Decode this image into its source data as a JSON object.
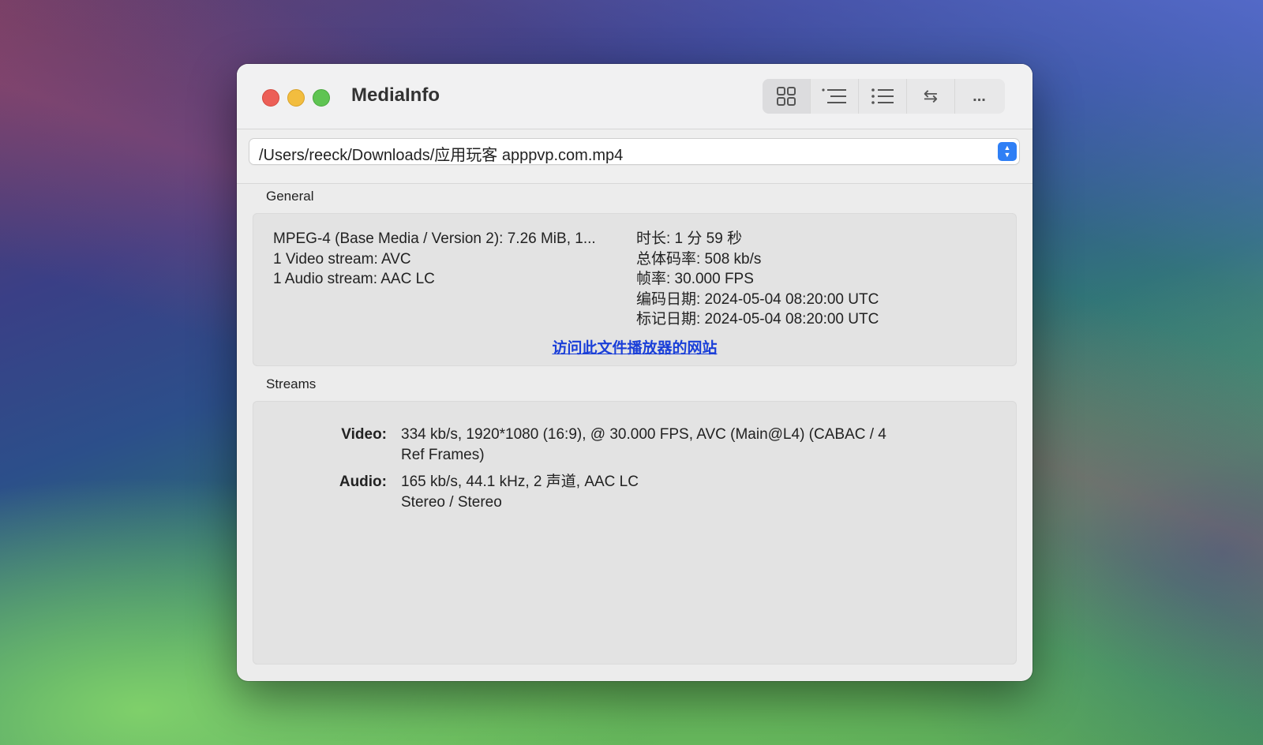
{
  "window": {
    "title": "MediaInfo"
  },
  "toolbar": {
    "buttons": [
      {
        "name": "grid-view",
        "icon": "grid-icon"
      },
      {
        "name": "outline-view",
        "icon": "outline-list-icon"
      },
      {
        "name": "list-view",
        "icon": "bullet-list-icon"
      },
      {
        "name": "swap",
        "icon": "swap-arrows-icon",
        "glyph": "⇆"
      },
      {
        "name": "more",
        "icon": "ellipsis-icon",
        "glyph": "..."
      }
    ]
  },
  "path": {
    "value": "/Users/reeck/Downloads/应用玩客 apppvp.com.mp4"
  },
  "general": {
    "label": "General",
    "left": [
      "MPEG-4 (Base Media / Version 2): 7.26 MiB, 1...",
      "1 Video stream: AVC",
      "1 Audio stream: AAC LC"
    ],
    "right": [
      "时长: 1 分 59 秒",
      "总体码率: 508 kb/s",
      "帧率: 30.000 FPS",
      "编码日期: 2024-05-04 08:20:00 UTC",
      "标记日期: 2024-05-04 08:20:00 UTC"
    ],
    "link": "访问此文件播放器的网站"
  },
  "streams": {
    "label": "Streams",
    "video": {
      "key": "Video:",
      "line1": "334 kb/s, 1920*1080 (16:9), @ 30.000 FPS, AVC (Main@L4) (CABAC / 4",
      "line2": "Ref Frames)"
    },
    "audio": {
      "key": "Audio:",
      "line1": "165 kb/s, 44.1 kHz, 2 声道, AAC LC",
      "line2": "Stereo / Stereo"
    }
  },
  "colors": {
    "close": "#ec5f57",
    "minimize": "#f2bd3f",
    "maximize": "#5fc452",
    "accent": "#2f7ff5",
    "link": "#1a3fd8"
  }
}
